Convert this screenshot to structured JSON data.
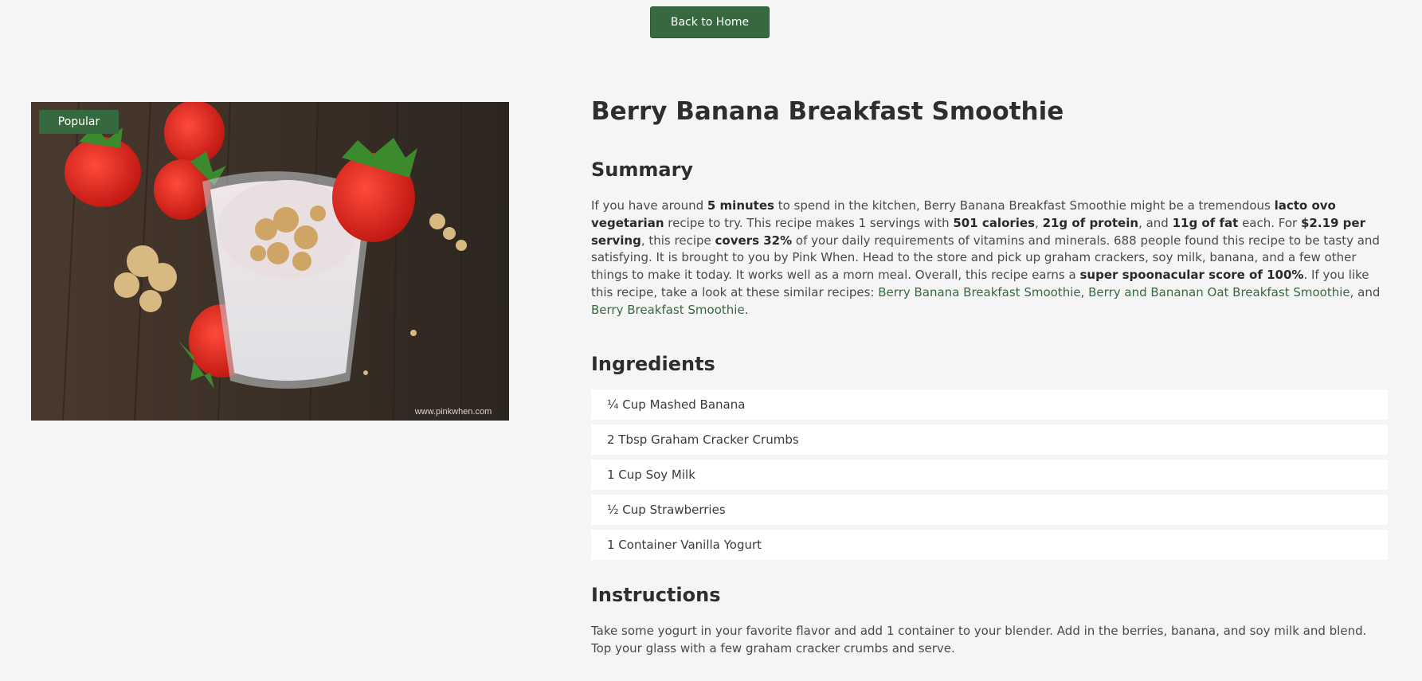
{
  "nav": {
    "back_label": "Back to Home"
  },
  "image": {
    "badge": "Popular",
    "watermark": "www.pinkwhen.com"
  },
  "recipe": {
    "title": "Berry Banana Breakfast Smoothie",
    "summary_heading": "Summary",
    "summary_parts": [
      {
        "t": "If you have around "
      },
      {
        "t": "5 minutes",
        "b": true
      },
      {
        "t": " to spend in the kitchen, Berry Banana Breakfast Smoothie might be a tremendous "
      },
      {
        "t": "lacto ovo vegetarian",
        "b": true
      },
      {
        "t": " recipe to try. This recipe makes 1 servings with "
      },
      {
        "t": "501 calories",
        "b": true
      },
      {
        "t": ", "
      },
      {
        "t": "21g of protein",
        "b": true
      },
      {
        "t": ", and "
      },
      {
        "t": "11g of fat",
        "b": true
      },
      {
        "t": " each. For "
      },
      {
        "t": "$2.19 per serving",
        "b": true
      },
      {
        "t": ", this recipe "
      },
      {
        "t": "covers 32%",
        "b": true
      },
      {
        "t": " of your daily requirements of vitamins and minerals. 688 people found this recipe to be tasty and satisfying. It is brought to you by Pink When. Head to the store and pick up graham crackers, soy milk, banana, and a few other things to make it today. It works well as a morn meal. Overall, this recipe earns a "
      },
      {
        "t": "super spoonacular score of 100%",
        "b": true
      },
      {
        "t": ". If you like this recipe, take a look at these similar recipes: "
      },
      {
        "t": "Berry Banana Breakfast Smoothie",
        "link": true
      },
      {
        "t": ", "
      },
      {
        "t": "Berry and Bananan Oat Breakfast Smoothie",
        "link": true
      },
      {
        "t": ", and "
      },
      {
        "t": "Berry Breakfast Smoothie",
        "link": true
      },
      {
        "t": "."
      }
    ],
    "ingredients_heading": "Ingredients",
    "ingredients": [
      "¼ Cup Mashed Banana",
      "2 Tbsp Graham Cracker Crumbs",
      "1 Cup Soy Milk",
      "½ Cup Strawberries",
      "1 Container Vanilla Yogurt"
    ],
    "instructions_heading": "Instructions",
    "instructions": "Take some yogurt in your favorite flavor and add 1 container to your blender. Add in the berries, banana, and soy milk and blend. Top your glass with a few graham cracker crumbs and serve."
  },
  "colors": {
    "accent": "#36693f",
    "background": "#f5f5f5",
    "card": "#ffffff"
  }
}
